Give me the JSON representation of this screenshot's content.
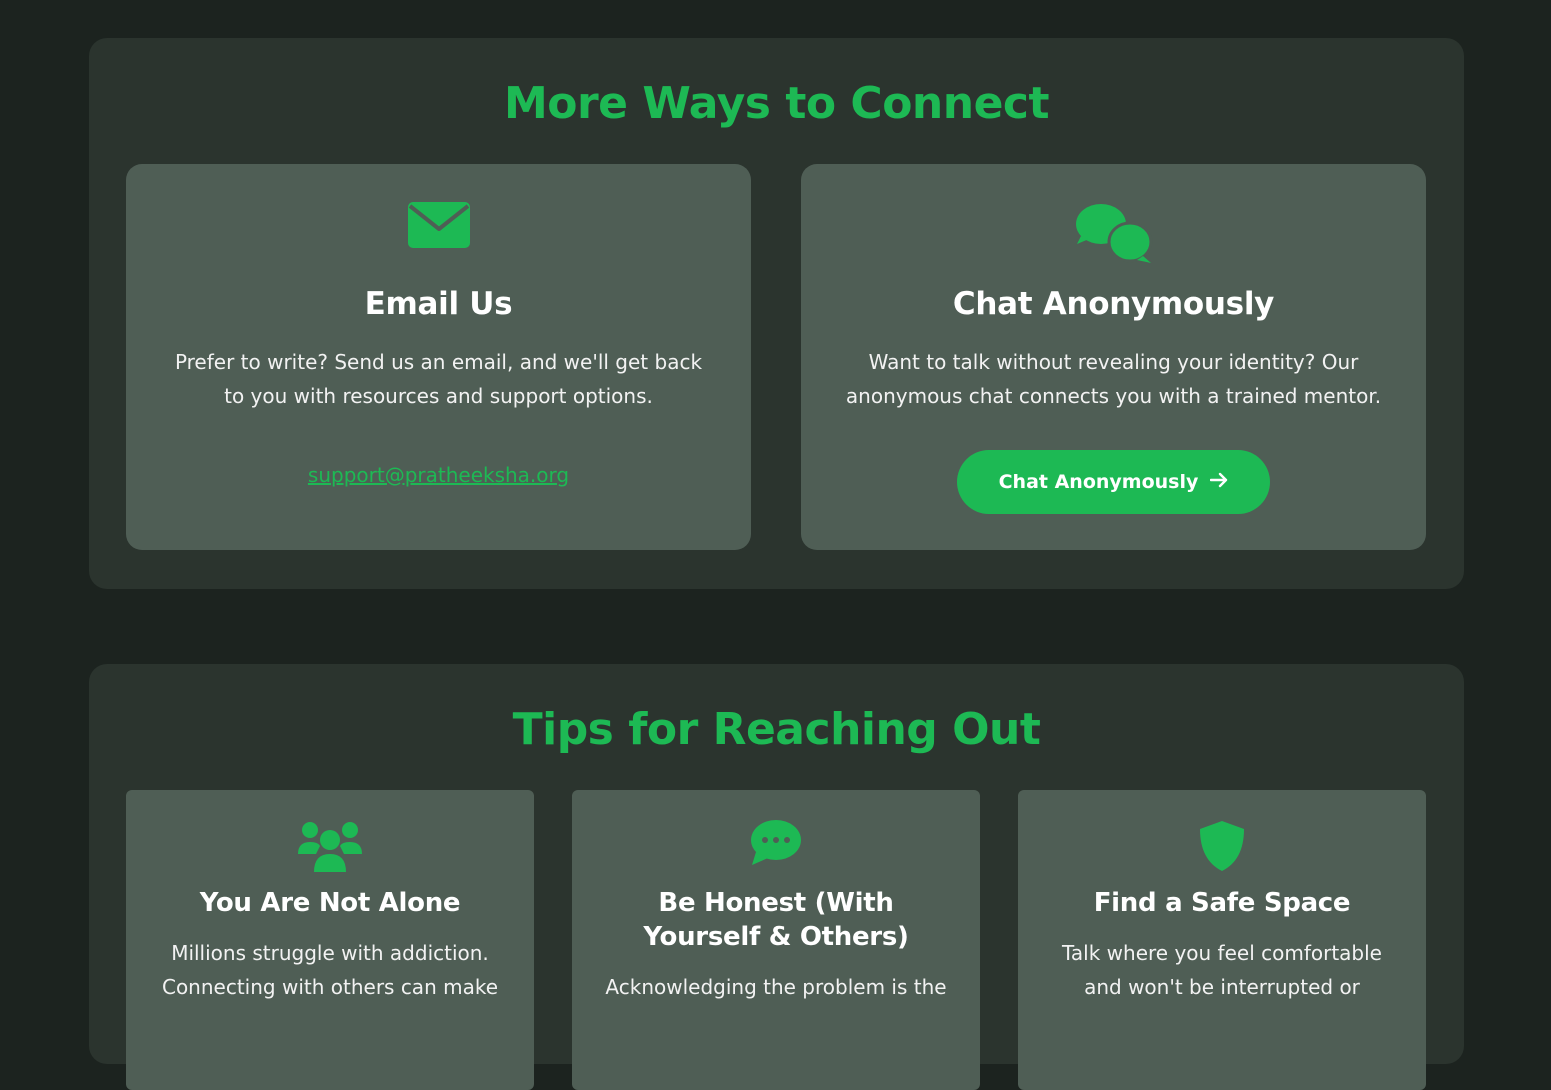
{
  "colors": {
    "page_bg": "#1c231f",
    "section_bg": "#2b342e",
    "card_bg": "#4f5e55",
    "accent": "#1db954",
    "text": "#ffffff"
  },
  "connect": {
    "title": "More Ways to Connect",
    "email": {
      "icon": "envelope-icon",
      "title": "Email Us",
      "text": "Prefer to write? Send us an email, and we'll get back to you with resources and support options.",
      "link": "support@pratheeksha.org"
    },
    "chat": {
      "icon": "chat-bubbles-icon",
      "title": "Chat Anonymously",
      "text": "Want to talk without revealing your identity? Our anonymous chat connects you with a trained mentor.",
      "button_label": "Chat Anonymously",
      "button_icon": "arrow-right-icon"
    }
  },
  "tips": {
    "title": "Tips for Reaching Out",
    "cards": [
      {
        "icon": "users-icon",
        "title": "You Are Not Alone",
        "text": "Millions struggle with addiction. Connecting with others can make"
      },
      {
        "icon": "speech-bubble-icon",
        "title": "Be Honest (With Yourself & Others)",
        "text": "Acknowledging the problem is the"
      },
      {
        "icon": "shield-icon",
        "title": "Find a Safe Space",
        "text": "Talk where you feel comfortable and won't be interrupted or"
      }
    ]
  }
}
